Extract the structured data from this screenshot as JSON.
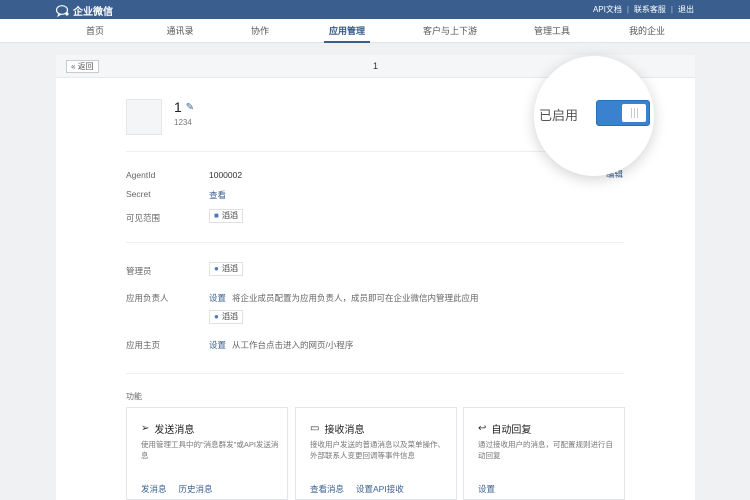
{
  "topbar": {
    "logo_text": "企业微信",
    "links": [
      "API文档",
      "联系客服",
      "退出"
    ]
  },
  "nav": {
    "items": [
      "首页",
      "通讯录",
      "协作",
      "应用管理",
      "客户与上下游",
      "管理工具",
      "我的企业"
    ],
    "active": "应用管理"
  },
  "panel": {
    "back_label": "« 返回",
    "title": "1"
  },
  "app": {
    "name": "1",
    "description": "1234",
    "status_label": "已启用",
    "enabled": true,
    "edit_label": "编辑"
  },
  "info": {
    "agentid_label": "AgentId",
    "agentid_value": "1000002",
    "secret_label": "Secret",
    "secret_link": "查看",
    "scope_label": "可见范围",
    "scope_tag": "滔滔"
  },
  "admin": {
    "admin_label": "管理员",
    "admin_tag": "滔滔",
    "owner_label": "应用负责人",
    "owner_link": "设置",
    "owner_hint": "将企业成员配置为应用负责人，成员即可在企业微信内管理此应用",
    "owner_tag": "滔滔",
    "homepage_label": "应用主页",
    "homepage_link": "设置",
    "homepage_hint": "从工作台点击进入的网页/小程序"
  },
  "features": {
    "section_label": "功能",
    "cards": [
      {
        "title": "发送消息",
        "icon": "send-icon",
        "description": "使用管理工具中的\"消息群发\"或API发送消息",
        "links": [
          "发消息",
          "历史消息"
        ]
      },
      {
        "title": "接收消息",
        "icon": "chat-icon",
        "description": "接收用户发送的普通消息以及菜单操作、外部联系人变更回调等事件信息",
        "links": [
          "查看消息",
          "设置API接收"
        ]
      },
      {
        "title": "自动回复",
        "icon": "reply-icon",
        "description": "通过接收用户的消息，可配置规则进行自动回复",
        "links": [
          "设置"
        ]
      }
    ]
  }
}
